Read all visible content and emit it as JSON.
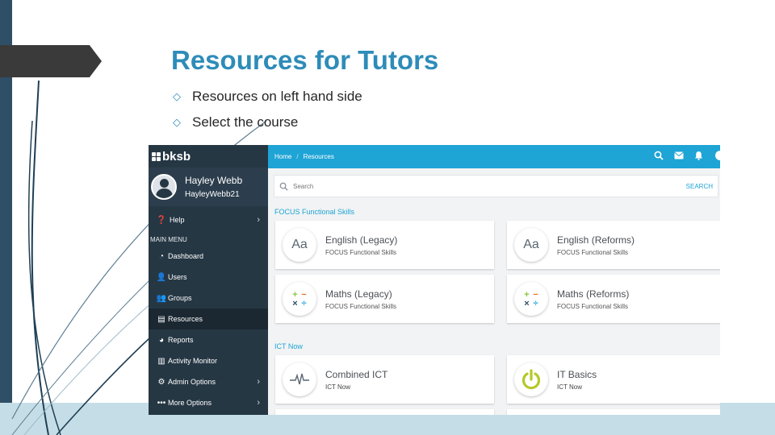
{
  "slide": {
    "title": "Resources for Tutors",
    "bullets": [
      "Resources on left hand side",
      "Select the course"
    ]
  },
  "app": {
    "logo": "bksb",
    "user": {
      "name": "Hayley Webb",
      "handle": "HayleyWebb21"
    },
    "sidebar": {
      "help": "Help",
      "menu_heading": "MAIN MENU",
      "items": [
        {
          "label": "Dashboard",
          "icon": "dashboard-icon"
        },
        {
          "label": "Users",
          "icon": "user-icon"
        },
        {
          "label": "Groups",
          "icon": "group-icon"
        },
        {
          "label": "Resources",
          "icon": "resources-icon",
          "active": true
        },
        {
          "label": "Reports",
          "icon": "pie-chart-icon"
        },
        {
          "label": "Activity Monitor",
          "icon": "bar-chart-icon"
        },
        {
          "label": "Admin Options",
          "icon": "gears-icon",
          "has_submenu": true
        },
        {
          "label": "More Options",
          "icon": "more-dots-icon",
          "has_submenu": true
        }
      ]
    },
    "breadcrumb": {
      "home": "Home",
      "current": "Resources"
    },
    "topbar_icons": [
      "search-icon",
      "mail-icon",
      "bell-icon"
    ],
    "search": {
      "placeholder": "Search",
      "button": "SEARCH"
    },
    "sections": [
      {
        "heading": "FOCUS Functional Skills",
        "cards": [
          {
            "title": "English (Legacy)",
            "subtitle": "FOCUS Functional Skills",
            "icon": "Aa"
          },
          {
            "title": "English (Reforms)",
            "subtitle": "FOCUS Functional Skills",
            "icon": "Aa"
          },
          {
            "title": "Maths (Legacy)",
            "subtitle": "FOCUS Functional Skills",
            "icon": "math-operators-icon"
          },
          {
            "title": "Maths (Reforms)",
            "subtitle": "FOCUS Functional Skills",
            "icon": "math-operators-icon"
          }
        ]
      },
      {
        "heading": "ICT Now",
        "cards": [
          {
            "title": "Combined ICT",
            "subtitle": "ICT Now",
            "icon": "pulse-icon"
          },
          {
            "title": "IT Basics",
            "subtitle": "ICT Now",
            "icon": "power-icon"
          }
        ]
      }
    ],
    "colors": {
      "accent": "#1ea4d5",
      "sidebar": "#263744",
      "title": "#2e8cb8",
      "plus": "#8cc63f",
      "minus": "#f36f21",
      "power": "#b5c828"
    }
  }
}
